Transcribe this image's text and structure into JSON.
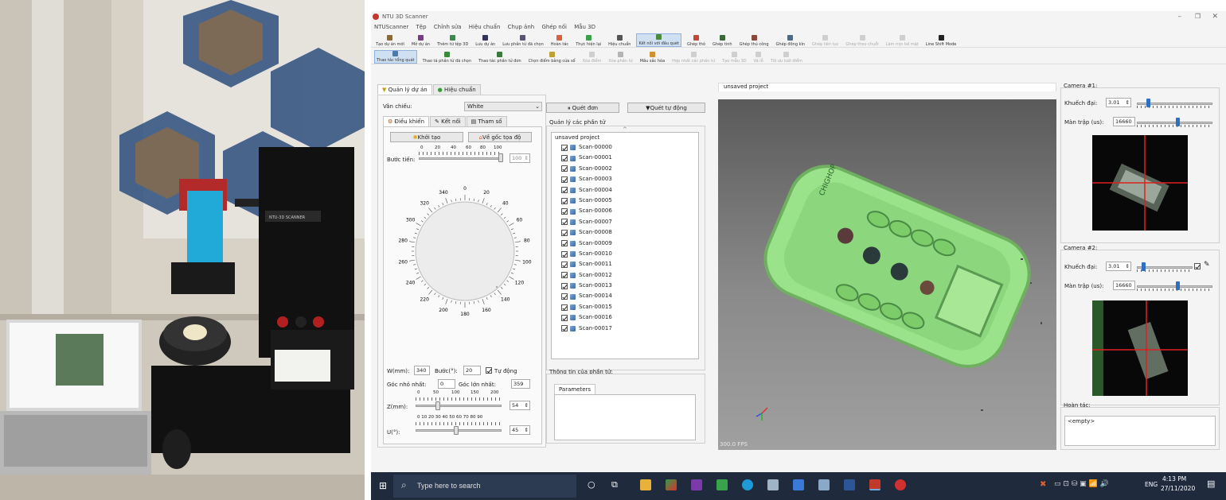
{
  "window": {
    "title": "NTU 3D Scanner"
  },
  "menu": [
    "NTUScanner",
    "Tệp",
    "Chỉnh sửa",
    "Hiệu chuẩn",
    "Chụp ảnh",
    "Ghép nối",
    "Mẫu 3D"
  ],
  "toolbar1": [
    {
      "label": "Tạo dự án mới",
      "color": "#8a6a3a",
      "state": "normal"
    },
    {
      "label": "Mở dự án",
      "color": "#7a3a8a",
      "state": "normal"
    },
    {
      "label": "Thêm từ tệp 3D",
      "color": "#3a8a4a",
      "state": "normal"
    },
    {
      "label": "Lưu dự án",
      "color": "#333355",
      "state": "normal"
    },
    {
      "label": "Lưu phần tử đã chọn",
      "color": "#555577",
      "state": "normal"
    },
    {
      "label": "Hoàn tác",
      "color": "#d9603a",
      "state": "normal"
    },
    {
      "label": "Thực hiện lại",
      "color": "#3aa04a",
      "state": "normal"
    },
    {
      "label": "Hiệu chuẩn",
      "color": "#555555",
      "state": "normal"
    },
    {
      "label": "Kết nối với đầu quét",
      "color": "#4a8a3a",
      "state": "active"
    },
    {
      "label": "Ghép thô",
      "color": "#c04a3a",
      "state": "normal"
    },
    {
      "label": "Ghép tinh",
      "color": "#3a6a3a",
      "state": "normal"
    },
    {
      "label": "Ghép thủ công",
      "color": "#8a4a3a",
      "state": "normal"
    },
    {
      "label": "Ghép đồng kín",
      "color": "#4a6a8a",
      "state": "normal"
    },
    {
      "label": "Ghép liên tục",
      "color": "#999999",
      "state": "disabled"
    },
    {
      "label": "Ghép theo chuỗi",
      "color": "#999999",
      "state": "disabled"
    },
    {
      "label": "Làm mịn bề mặt",
      "color": "#999999",
      "state": "disabled"
    },
    {
      "label": "Line Shift Mode",
      "color": "#222222",
      "state": "normal"
    }
  ],
  "toolbar2": [
    {
      "label": "Thao tác tổng quát",
      "color": "#4a7ab0",
      "state": "active"
    },
    {
      "label": "Thao tá phần tử đã chọn",
      "color": "#3a8a3a",
      "state": "normal"
    },
    {
      "label": "Thao tác phần tử đơn",
      "color": "#3a7a3a",
      "state": "normal"
    },
    {
      "label": "Chọn điểm bằng cửa sổ",
      "color": "#c0a030",
      "state": "normal"
    },
    {
      "label": "Xóa điểm",
      "color": "#999999",
      "state": "disabled"
    },
    {
      "label": "Xóa phần tử",
      "color": "#555555",
      "state": "disabled"
    },
    {
      "label": "Mầu sắc hóa",
      "color": "#d09030",
      "state": "normal"
    },
    {
      "label": "Hợp nhất các phần tử",
      "color": "#999999",
      "state": "disabled"
    },
    {
      "label": "Tạo mẫu 3D",
      "color": "#999999",
      "state": "disabled"
    },
    {
      "label": "Vá lỗ",
      "color": "#999999",
      "state": "disabled"
    },
    {
      "label": "Tối ưu lưới điểm",
      "color": "#999999",
      "state": "disabled"
    }
  ],
  "left": {
    "tabs": [
      "Quản lý dự án",
      "Hiệu chuẩn"
    ],
    "van_chieu_label": "Vân chiếu:",
    "van_chieu_value": "White",
    "subtabs": [
      "Điều khiển",
      "Kết nối",
      "Tham số"
    ],
    "btn_init": "Khởi tạo",
    "btn_home": "Về gốc tọa độ",
    "buoc_tien_label": "Bước tiến:",
    "buoc_tien_ticks": [
      "0",
      "20",
      "40",
      "60",
      "80",
      "100"
    ],
    "buoc_tien_value": "100",
    "dial_ticks": [
      "0",
      "20",
      "40",
      "60",
      "80",
      "100",
      "120",
      "140",
      "160",
      "180",
      "200",
      "220",
      "240",
      "260",
      "280",
      "300",
      "320",
      "340"
    ],
    "w_label": "W(mm):",
    "w_value": "340",
    "buoc_label": "Bước(°):",
    "buoc_value": "20",
    "tu_dong_label": "Tự động",
    "goc_min_label": "Góc nhỏ nhất:",
    "goc_min_value": "0",
    "goc_max_label": "Góc lớn nhất:",
    "goc_max_value": "359",
    "z_label": "Z(mm):",
    "z_ticks": [
      "0",
      "50",
      "100",
      "150",
      "200"
    ],
    "z_value": "54",
    "u_label": "U(°):",
    "u_ticks": "0 10 20 30 40 50 60 70 80 90",
    "u_value": "45"
  },
  "mid": {
    "btn_single": "Quét đơn",
    "btn_auto": "Quét tự động",
    "manage_label": "Quản lý các phần tử",
    "root": "unsaved project",
    "scans": [
      "Scan-00000",
      "Scan-00001",
      "Scan-00002",
      "Scan-00003",
      "Scan-00004",
      "Scan-00005",
      "Scan-00006",
      "Scan-00007",
      "Scan-00008",
      "Scan-00009",
      "Scan-00010",
      "Scan-00011",
      "Scan-00012",
      "Scan-00013",
      "Scan-00014",
      "Scan-00015",
      "Scan-00016",
      "Scan-00017"
    ],
    "info_label": "Thông tin của phần tử:",
    "info_tab": "Parameters"
  },
  "viewport": {
    "title": "unsaved project",
    "fps": "300.0 FPS"
  },
  "cam1": {
    "title": "Camera #1:",
    "gain_label": "Khuếch đại:",
    "gain_value": "3.01",
    "shutter_label": "Màn trập (us):",
    "shutter_value": "16660"
  },
  "cam2": {
    "title": "Camera #2:",
    "gain_label": "Khuếch đại:",
    "gain_value": "3.01",
    "shutter_label": "Màn trập (us):",
    "shutter_value": "16660"
  },
  "undo": {
    "title": "Hoàn tác:",
    "item": "<empty>"
  },
  "taskbar": {
    "search": "Type here to search",
    "lang": "ENG",
    "time": "4:13 PM",
    "date": "27/11/2020"
  }
}
